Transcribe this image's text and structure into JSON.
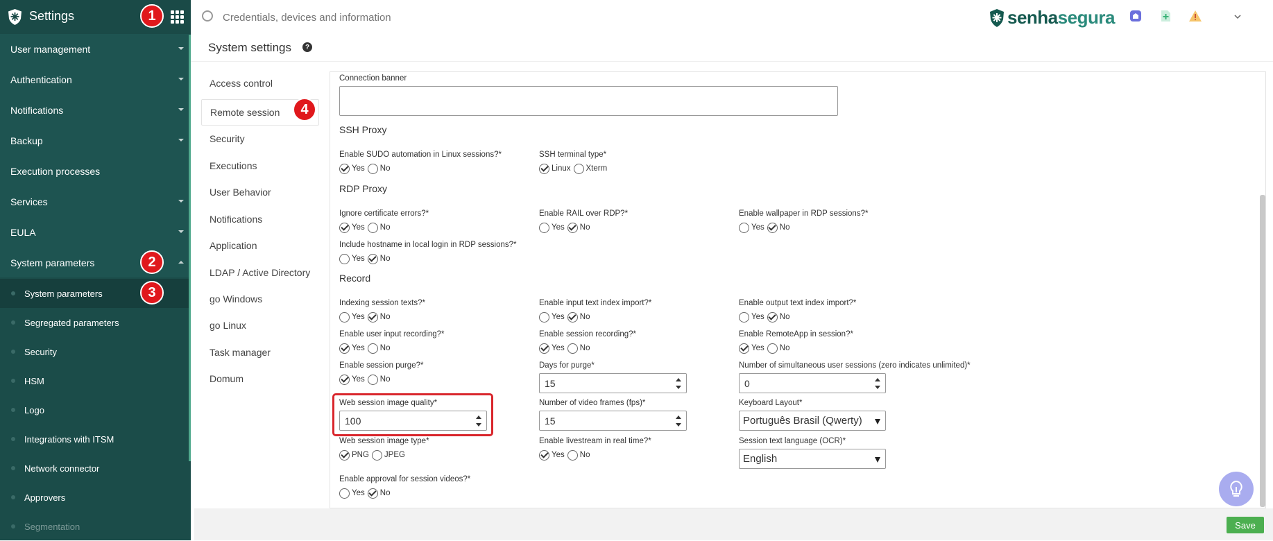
{
  "app": {
    "title": "Settings"
  },
  "search": {
    "placeholder": "Credentials, devices and information"
  },
  "brand": {
    "part1": "senha",
    "part2": "segura"
  },
  "sidebar": {
    "menus": [
      {
        "label": "User management"
      },
      {
        "label": "Authentication"
      },
      {
        "label": "Notifications"
      },
      {
        "label": "Backup"
      },
      {
        "label": "Execution processes"
      },
      {
        "label": "Services"
      },
      {
        "label": "EULA"
      },
      {
        "label": "System parameters"
      }
    ],
    "sub_items": [
      {
        "label": "System parameters"
      },
      {
        "label": "Segregated parameters"
      },
      {
        "label": "Security"
      },
      {
        "label": "HSM"
      },
      {
        "label": "Logo"
      },
      {
        "label": "Integrations with ITSM"
      },
      {
        "label": "Network connector"
      },
      {
        "label": "Approvers"
      },
      {
        "label": "Segmentation"
      }
    ]
  },
  "badges": {
    "b1": "1",
    "b2": "2",
    "b3": "3",
    "b4": "4"
  },
  "page": {
    "title": "System settings",
    "help": "?"
  },
  "tabs": [
    {
      "label": "Access control"
    },
    {
      "label": "Remote session"
    },
    {
      "label": "Security"
    },
    {
      "label": "Executions"
    },
    {
      "label": "User Behavior"
    },
    {
      "label": "Notifications"
    },
    {
      "label": "Application"
    },
    {
      "label": "LDAP / Active Directory"
    },
    {
      "label": "go Windows"
    },
    {
      "label": "go Linux"
    },
    {
      "label": "Task manager"
    },
    {
      "label": "Domum"
    }
  ],
  "form": {
    "connection_banner": "Connection banner",
    "ssh_proxy": "SSH Proxy",
    "sudo_label": "Enable SUDO automation in Linux sessions?*",
    "ssh_term_label": "SSH terminal type*",
    "rdp_proxy": "RDP Proxy",
    "ignore_cert_label": "Ignore certificate errors?*",
    "rail_label": "Enable RAIL over RDP?*",
    "wallpaper_label": "Enable wallpaper in RDP sessions?*",
    "hostname_label": "Include hostname in local login in RDP sessions?*",
    "record": "Record",
    "indexing_label": "Indexing session texts?*",
    "input_index_label": "Enable input text index import?*",
    "output_index_label": "Enable output text index import?*",
    "user_input_label": "Enable user input recording?*",
    "session_rec_label": "Enable session recording?*",
    "remoteapp_label": "Enable RemoteApp in session?*",
    "purge_label": "Enable session purge?*",
    "days_purge_label": "Days for purge*",
    "days_purge_value": "15",
    "simul_label": "Number of simultaneous user sessions (zero indicates unlimited)*",
    "simul_value": "0",
    "web_quality_label": "Web session image quality*",
    "web_quality_value": "100",
    "fps_label": "Number of video frames (fps)*",
    "fps_value": "15",
    "keyboard_label": "Keyboard Layout*",
    "keyboard_value": "Português Brasil (Qwerty)",
    "web_type_label": "Web session image type*",
    "livestream_label": "Enable livestream in real time?*",
    "ocr_label": "Session text language (OCR)*",
    "ocr_value": "English",
    "approval_label": "Enable approval for session videos?*",
    "yes": "Yes",
    "no": "No",
    "linux": "Linux",
    "xterm": "Xterm",
    "png": "PNG",
    "jpeg": "JPEG"
  },
  "footer": {
    "save": "Save"
  },
  "colors": {
    "sidebar": "#1e5451",
    "accent": "#4caf50",
    "badge": "#e0181c",
    "highlight": "#d9262c"
  }
}
